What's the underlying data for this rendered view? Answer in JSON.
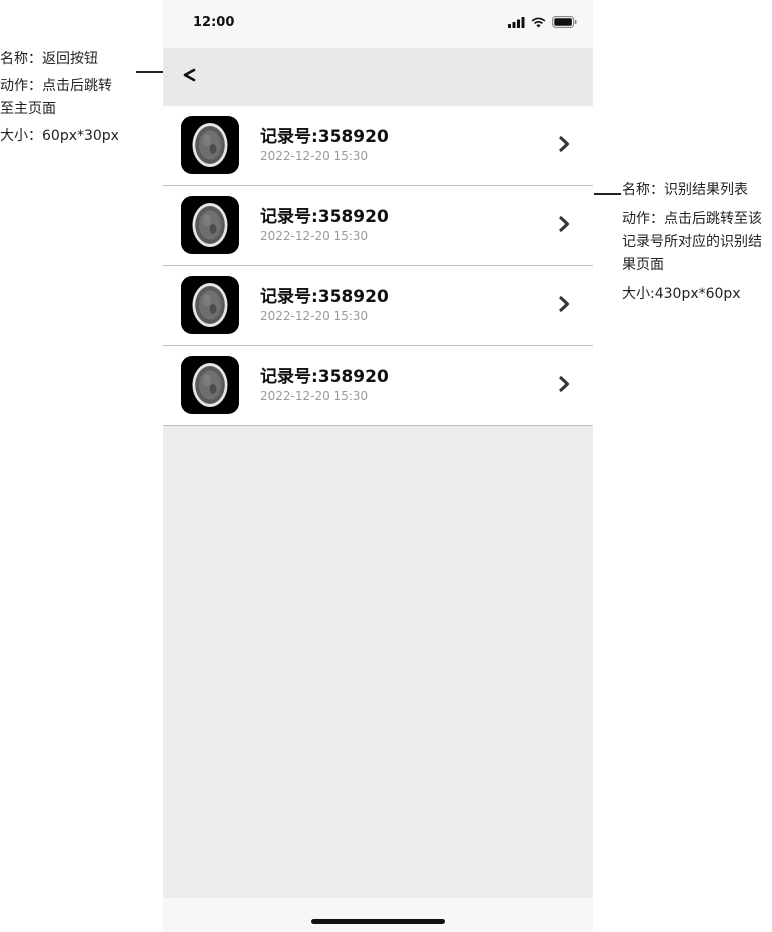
{
  "annotations": {
    "back": {
      "name": "名称：返回按钮",
      "action_line1": "动作：点击后跳转",
      "action_line2": "至主页面",
      "size": "大小：60px*30px"
    },
    "list": {
      "name": "名称：识别结果列表",
      "action": "动作：点击后跳转至该记录号所对应的识别结果页面",
      "size": "大小:430px*60px"
    }
  },
  "status_bar": {
    "time": "12:00",
    "icons": [
      "cellular-signal-icon",
      "wifi-icon",
      "battery-icon"
    ]
  },
  "nav": {
    "back_icon": "chevron-left-icon"
  },
  "records": [
    {
      "title": "记录号:358920",
      "date": "2022-12-20 15:30"
    },
    {
      "title": "记录号:358920",
      "date": "2022-12-20 15:30"
    },
    {
      "title": "记录号:358920",
      "date": "2022-12-20 15:30"
    },
    {
      "title": "记录号:358920",
      "date": "2022-12-20 15:30"
    }
  ],
  "colors": {
    "background": "#ececec",
    "row_background": "#ffffff",
    "divider": "#bdbdbd",
    "title_text": "#111111",
    "date_text": "#999999"
  }
}
